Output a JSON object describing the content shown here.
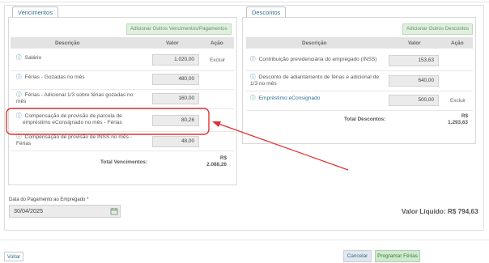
{
  "vencimentos": {
    "tab_label": "Vencimentos",
    "add_button_label": "Adicionar Outros Vencimentos/Pagamentos",
    "columns": [
      "Descrição",
      "Valor",
      "Ação"
    ],
    "rows": [
      {
        "lines": [
          "Salário"
        ],
        "value": "1.020,00",
        "action": "Excluir"
      },
      {
        "lines": [
          "Férias - Gozadas no mês"
        ],
        "value": "480,00",
        "action": ""
      },
      {
        "lines": [
          "Férias - Adicional 1/3 sobre férias gozadas no",
          "mês"
        ],
        "value": "160,00",
        "action": ""
      },
      {
        "lines": [
          "Compensação de provisão de parcela de",
          "empréstimo eConsignado no mês - Férias"
        ],
        "value": "80,26",
        "action": ""
      },
      {
        "lines": [
          "Compensação de provisão de INSS no mês -",
          "Férias"
        ],
        "value": "48,00",
        "action": ""
      }
    ],
    "total_label": "Total Vencimentos:",
    "total_value_lines": [
      "R$",
      "2.088,26"
    ]
  },
  "descontos": {
    "tab_label": "Descontos",
    "add_button_label": "Adicionar Outros Descontos",
    "columns": [
      "Descrição",
      "Valor",
      "Ação"
    ],
    "rows": [
      {
        "lines": [
          "Contribuição previdenciária do empregado (INSS)"
        ],
        "value": "153,63",
        "action": ""
      },
      {
        "lines": [
          "Desconto de adiantamento de férias e adicional de",
          "1/3 no mês"
        ],
        "value": "640,00",
        "action": ""
      },
      {
        "lines": [
          "Empréstimo eConsignado"
        ],
        "value": "500,00",
        "action": "Excluir"
      }
    ],
    "total_label": "Total Descontos:",
    "total_value_lines": [
      "R$",
      "1.293,63"
    ]
  },
  "payment_date": {
    "label": "Data do Pagamento ao Empregado *",
    "value": "30/04/2025",
    "icon": "calendar-icon"
  },
  "valor_liquido": "Valor Líquido: R$ 794,63",
  "buttons": {
    "voltar": "Voltar",
    "cancelar": "Cancelar",
    "programar": "Programar Férias"
  },
  "annotation": {
    "color": "#e03030"
  },
  "colors": {
    "link": "#2f6f8f",
    "green_button": "#dff0df",
    "header": "#e3e3e3"
  }
}
